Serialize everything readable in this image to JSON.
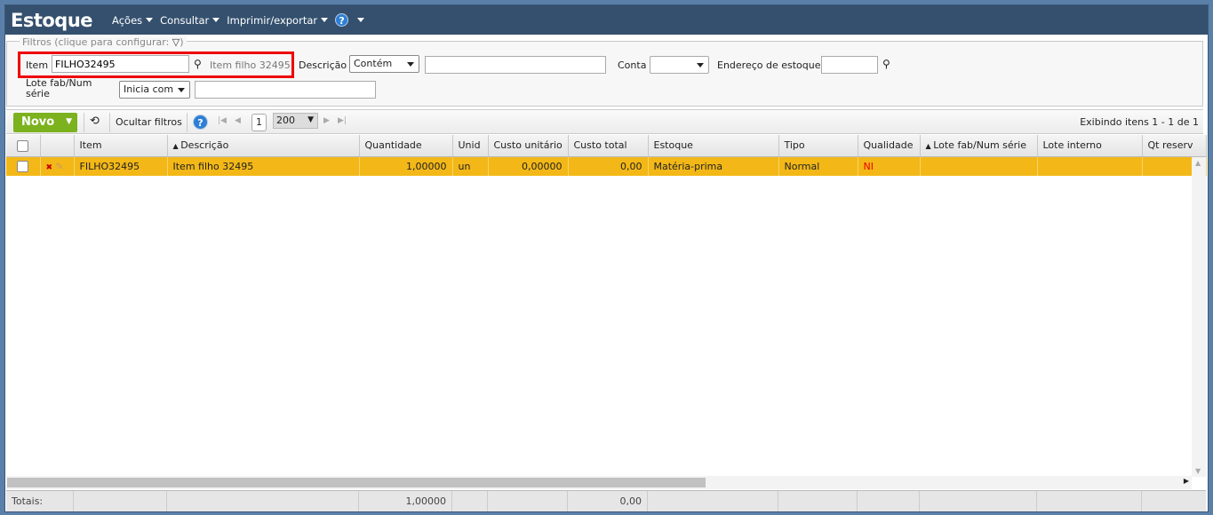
{
  "header": {
    "title": "Estoque",
    "menus": [
      "Ações",
      "Consultar",
      "Imprimir/exportar"
    ],
    "help": "?"
  },
  "filters": {
    "legend": "Filtros (clique para configurar:",
    "legend_end": ")",
    "item_label": "Item",
    "item_value": "FILHO32495",
    "item_desc": "Item filho 32495",
    "descricao_label": "Descrição",
    "descricao_mode": "Contém",
    "descricao_value": "",
    "conta_label": "Conta",
    "conta_value": "",
    "endereco_label": "Endereço de estoque",
    "endereco_value": "",
    "lote_label_1": "Lote fab/Num",
    "lote_label_2": "série",
    "lote_mode": "Inicia com",
    "lote_value": ""
  },
  "toolbar": {
    "novo": "Novo",
    "ocultar": "Ocultar filtros",
    "page": "1",
    "page_size": "200",
    "showing": "Exibindo itens 1 - 1 de 1"
  },
  "columns": [
    "Item",
    "Descrição",
    "Quantidade",
    "Unid",
    "Custo unitário",
    "Custo total",
    "Estoque",
    "Tipo",
    "Qualidade",
    "Lote fab/Num série",
    "Lote interno",
    "Qt reserv"
  ],
  "rows": [
    {
      "item": "FILHO32495",
      "descricao": "Item filho 32495",
      "quantidade": "1,00000",
      "unid": "un",
      "custo_unitario": "0,00000",
      "custo_total": "0,00",
      "estoque": "Matéria-prima",
      "tipo": "Normal",
      "qualidade": "NI",
      "lote_fab": "",
      "lote_interno": "",
      "qt_reserv": ""
    }
  ],
  "totals": {
    "label": "Totais:",
    "quantidade": "1,00000",
    "custo_total": "0,00"
  },
  "colors": {
    "header": "#34506e",
    "selected_row": "#f3b817",
    "novo": "#7bb21e",
    "highlight": "#e00000"
  }
}
